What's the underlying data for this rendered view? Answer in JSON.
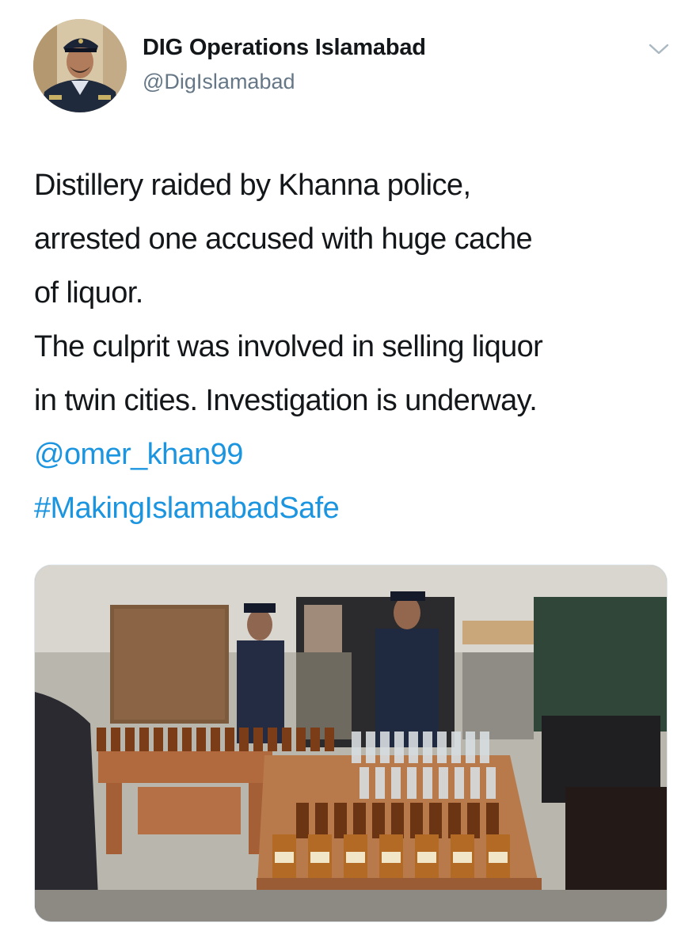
{
  "author": {
    "display_name": "DIG Operations Islamabad",
    "handle": "@DigIslamabad"
  },
  "tweet": {
    "lines": [
      "Distillery raided by Khanna police,",
      "arrested one accused with huge cache",
      "of liquor.",
      "The culprit was involved in selling liquor",
      "in twin cities. Investigation is underway."
    ],
    "mention": "@omer_khan99",
    "hashtag": "#MakingIslamabadSafe"
  },
  "media": {
    "type": "photo",
    "subject": "Police officers standing behind tables with rows of seized liquor bottles"
  },
  "icons": {
    "menu": "chevron-down-icon"
  },
  "colors": {
    "text": "#14171a",
    "secondary": "#657786",
    "link": "#1b95e0",
    "background": "#ffffff"
  }
}
